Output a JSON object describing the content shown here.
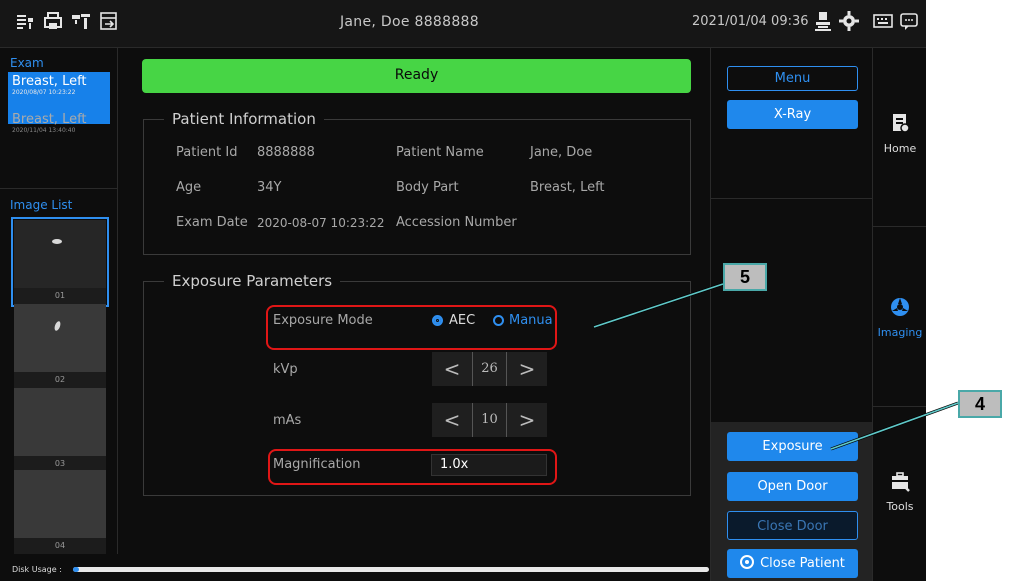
{
  "header": {
    "patient_title": "Jane, Doe  8888888",
    "datetime": "2021/01/04 09:36"
  },
  "exam": {
    "section_label": "Exam",
    "items": [
      {
        "name": "Breast, Left",
        "date": "2020/08/07 10:23:22",
        "active": true
      },
      {
        "name": "Breast, Left",
        "date": "2020/11/04 13:40:40",
        "active": false
      }
    ]
  },
  "image_list": {
    "section_label": "Image List",
    "thumbs": [
      "01",
      "02",
      "03",
      "04"
    ]
  },
  "status": {
    "ready_label": "Ready"
  },
  "patient_info": {
    "legend": "Patient Information",
    "patient_id_label": "Patient Id",
    "patient_id": "8888888",
    "patient_name_label": "Patient Name",
    "patient_name": "Jane, Doe",
    "age_label": "Age",
    "age": "34Y",
    "body_part_label": "Body Part",
    "body_part": "Breast, Left",
    "exam_date_label": "Exam Date",
    "exam_date": "2020-08-07 10:23:22",
    "accession_label": "Accession Number",
    "accession": ""
  },
  "exposure": {
    "legend": "Exposure Parameters",
    "mode_label": "Exposure Mode",
    "mode_options": [
      "AEC",
      "Manua"
    ],
    "mode_selected": "AEC",
    "kvp_label": "kVp",
    "kvp_value": "26",
    "mas_label": "mAs",
    "mas_value": "10",
    "step_dec": "<",
    "step_inc": ">",
    "magnification_label": "Magnification",
    "magnification_value": "1.0x"
  },
  "controls": {
    "menu_label": "Menu",
    "xray_label": "X-Ray",
    "exposure_label": "Exposure",
    "open_door_label": "Open Door",
    "close_door_label": "Close Door",
    "close_patient_label": "Close Patient"
  },
  "nav": {
    "home_label": "Home",
    "imaging_label": "Imaging",
    "tools_label": "Tools"
  },
  "footer": {
    "disk_label": "Disk Usage :",
    "disk_usage_fraction": 0.01
  },
  "annotations": {
    "callout_4": "4",
    "callout_5": "5"
  },
  "colors": {
    "accent": "#1f88ec",
    "ready": "#47d545",
    "highlight": "#e01616",
    "callout_border": "#4aa8a8"
  }
}
